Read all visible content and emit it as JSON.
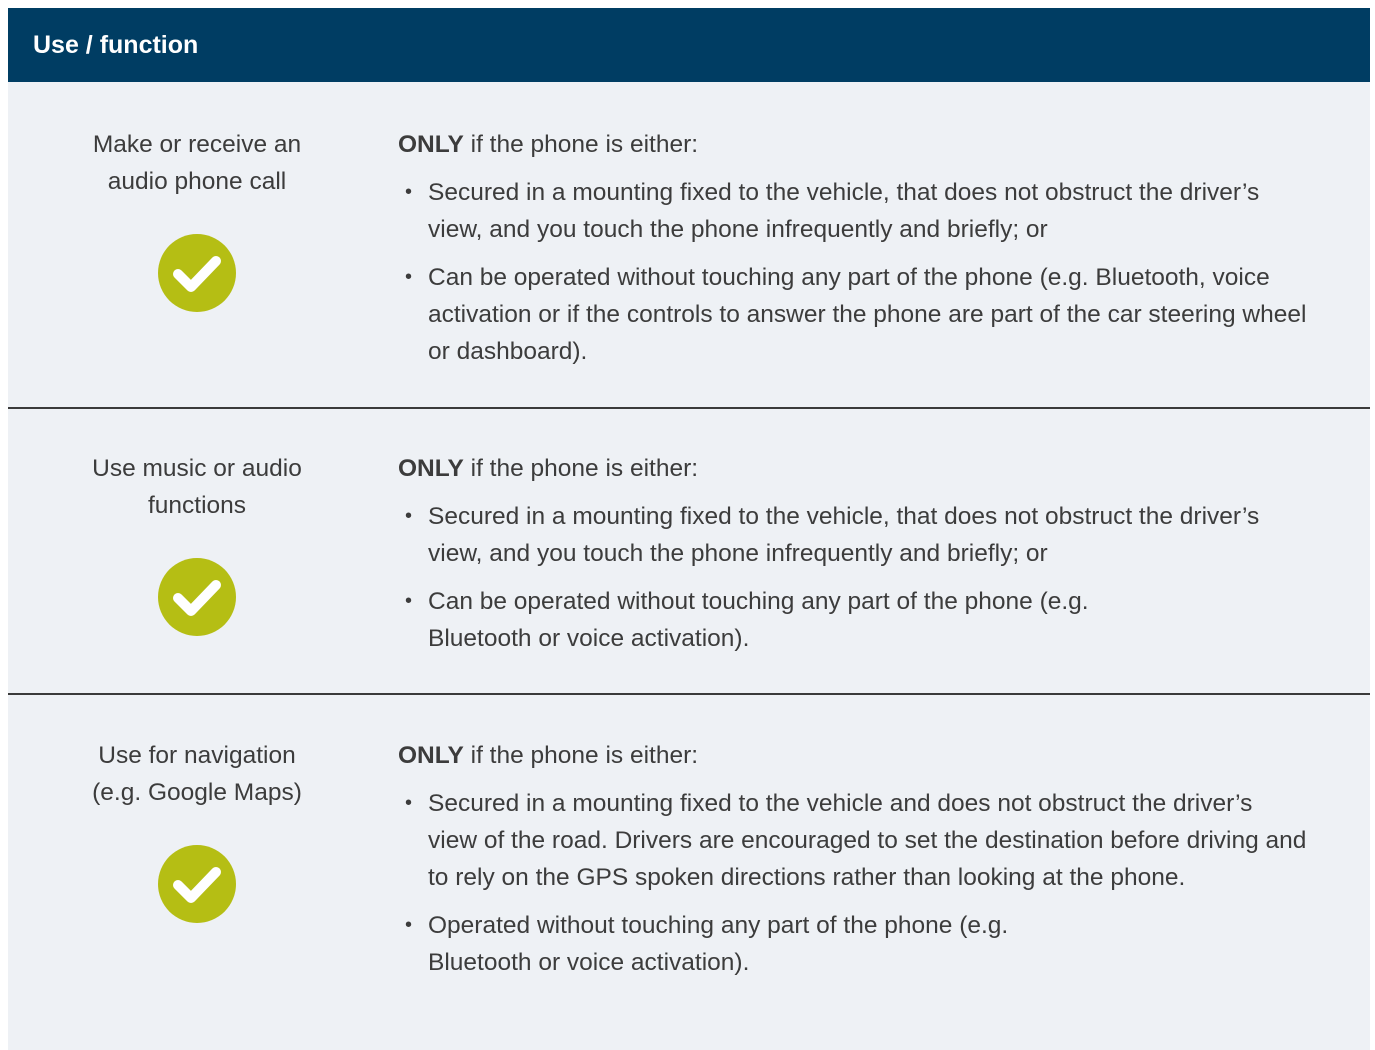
{
  "header": {
    "title": "Use / function"
  },
  "rows": [
    {
      "function": "Make or receive an audio phone call",
      "icon": "check-circle-icon",
      "intro_bold": "ONLY",
      "intro_rest": " if the phone is either:",
      "bullets": [
        "Secured in a mounting fixed to the vehicle, that does not obstruct the driver’s view, and you touch the phone infrequently and briefly; or",
        "Can be operated without touching any part of the phone (e.g. Bluetooth, voice activation or if the controls to answer the phone are part of the car steering wheel or dashboard)."
      ]
    },
    {
      "function": "Use music or audio functions",
      "icon": "check-circle-icon",
      "intro_bold": "ONLY",
      "intro_rest": " if the phone is either:",
      "bullets": [
        "Secured in a mounting fixed to the vehicle, that does not obstruct the driver’s view, and you touch the phone infrequently and briefly; or",
        "Can be operated without touching any part of the phone (e.g. Bluetooth or voice activation)."
      ]
    },
    {
      "function": "Use for navigation (e.g. Google Maps)",
      "icon": "check-circle-icon",
      "intro_bold": "ONLY",
      "intro_rest": " if the phone is either:",
      "bullets": [
        "Secured in a mounting fixed to the vehicle and does not obstruct the driver’s view of the road. Drivers are encouraged to set the destination before driving and to rely on the GPS spoken directions rather than looking at the phone.",
        "Operated without touching any part of the phone (e.g. Bluetooth or voice activation)."
      ]
    }
  ],
  "colors": {
    "header_bg": "#003d63",
    "header_text": "#ffffff",
    "row_bg": "#eef1f5",
    "check": "#b5be14",
    "divider": "#3a3a3a",
    "text": "#3c3c3c"
  }
}
